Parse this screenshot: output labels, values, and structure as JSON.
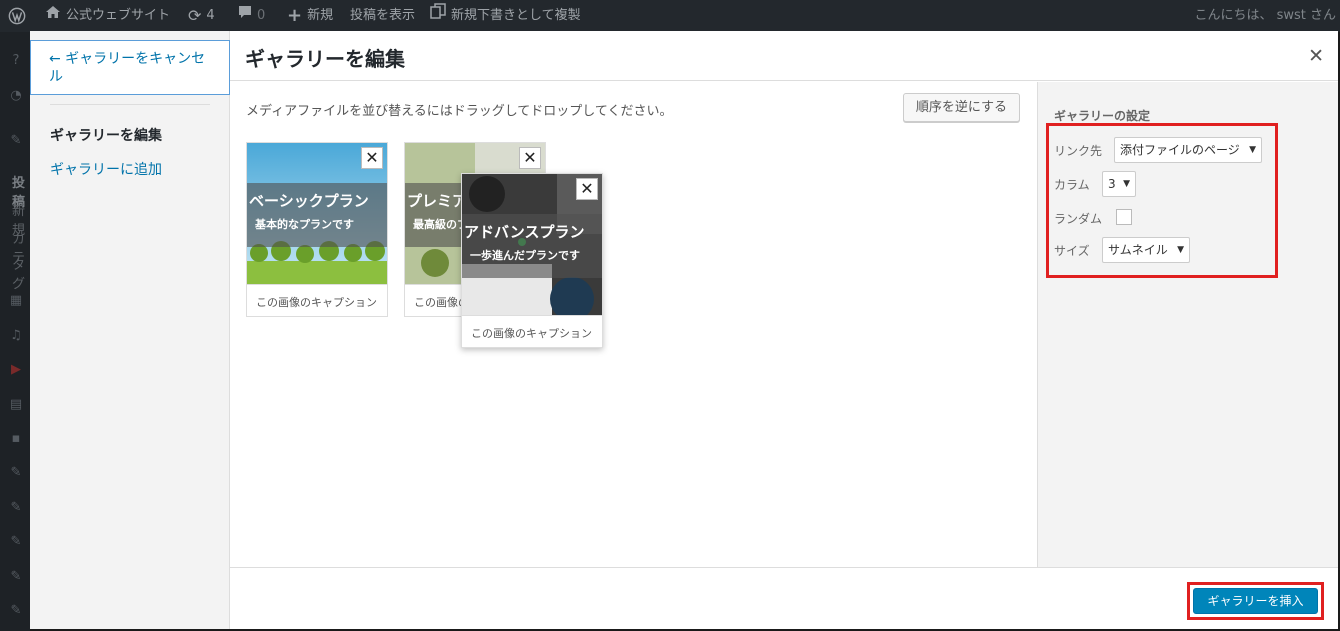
{
  "admin_bar": {
    "site_name": "公式ウェブサイト",
    "updates_count": "4",
    "comments_count": "0",
    "new_label": "新規",
    "view_post": "投稿を表示",
    "copy_draft": "新規下書きとして複製",
    "howdy": "こんにちは、 swst さん"
  },
  "left_menu": {
    "cancel": "← ギャラリーをキャンセル",
    "edit_gallery": "ギャラリーを編集",
    "add_to_gallery": "ギャラリーに追加"
  },
  "background_sidebar": [
    "投稿",
    "新規",
    "カテ",
    "タグ"
  ],
  "modal": {
    "title": "ギャラリーを編集",
    "close_icon": "close-icon",
    "instruction": "メディアファイルを並び替えるにはドラッグしてドロップしてください。",
    "reverse_button": "順序を逆にする"
  },
  "attachments": [
    {
      "title": "ベーシックプラン",
      "subtitle": "基本的なプランです",
      "caption": "この画像のキャプション"
    },
    {
      "title": "プレミアムプラン",
      "subtitle": "最高級のプランです",
      "caption": "この画像のキャプション"
    },
    {
      "title": "アドバンスプラン",
      "subtitle": "一歩進んだプランです",
      "caption": "この画像のキャプション"
    }
  ],
  "settings": {
    "heading": "ギャラリーの設定",
    "link_label": "リンク先",
    "link_value": "添付ファイルのページ",
    "columns_label": "カラム",
    "columns_value": "3",
    "random_label": "ランダム",
    "random_checked": false,
    "size_label": "サイズ",
    "size_value": "サムネイル"
  },
  "footer": {
    "insert_button": "ギャラリーを挿入"
  },
  "colors": {
    "primary_button": "#0085ba",
    "highlight_box": "#e02020",
    "admin_bar": "#23282d",
    "link": "#0073aa"
  }
}
